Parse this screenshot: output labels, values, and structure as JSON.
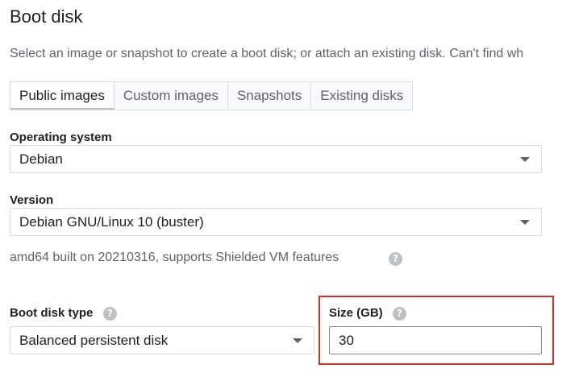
{
  "header": {
    "title": "Boot disk",
    "subtitle": "Select an image or snapshot to create a boot disk; or attach an existing disk. Can't find wh"
  },
  "tabs": [
    {
      "label": "Public images",
      "active": true
    },
    {
      "label": "Custom images",
      "active": false
    },
    {
      "label": "Snapshots",
      "active": false
    },
    {
      "label": "Existing disks",
      "active": false
    }
  ],
  "operating_system": {
    "label": "Operating system",
    "value": "Debian"
  },
  "version": {
    "label": "Version",
    "value": "Debian GNU/Linux 10 (buster)",
    "info": "amd64 built on 20210316, supports Shielded VM features"
  },
  "boot_disk_type": {
    "label": "Boot disk type",
    "value": "Balanced persistent disk"
  },
  "size": {
    "label": "Size (GB)",
    "value": "30"
  },
  "icons": {
    "help": "?"
  },
  "colors": {
    "highlight": "#d93025",
    "text_primary": "#202124",
    "text_secondary": "#5f6368",
    "border": "#dadce0"
  }
}
